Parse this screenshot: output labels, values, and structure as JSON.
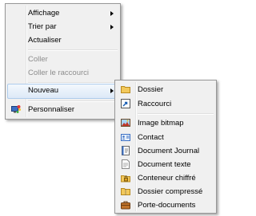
{
  "context_menu": {
    "items": [
      {
        "label": "Affichage"
      },
      {
        "label": "Trier par"
      },
      {
        "label": "Actualiser"
      },
      {
        "label": "Coller"
      },
      {
        "label": "Coller le raccourci"
      },
      {
        "label": "Nouveau"
      },
      {
        "label": "Personnaliser",
        "icon": "personalize-icon"
      }
    ]
  },
  "submenu": {
    "items": [
      {
        "label": "Dossier",
        "icon": "folder-icon"
      },
      {
        "label": "Raccourci",
        "icon": "shortcut-icon"
      },
      {
        "label": "Image bitmap",
        "icon": "bitmap-image-icon"
      },
      {
        "label": "Contact",
        "icon": "contact-card-icon"
      },
      {
        "label": "Document Journal",
        "icon": "journal-document-icon"
      },
      {
        "label": "Document texte",
        "icon": "text-document-icon"
      },
      {
        "label": "Conteneur chiffré",
        "icon": "encrypted-container-icon"
      },
      {
        "label": "Dossier compressé",
        "icon": "zip-folder-icon"
      },
      {
        "label": "Porte-documents",
        "icon": "briefcase-icon"
      }
    ]
  },
  "colors": {
    "menu_background": "#f0f0f0",
    "highlight_border": "#aeccec",
    "disabled_text": "#8d8d8d"
  }
}
